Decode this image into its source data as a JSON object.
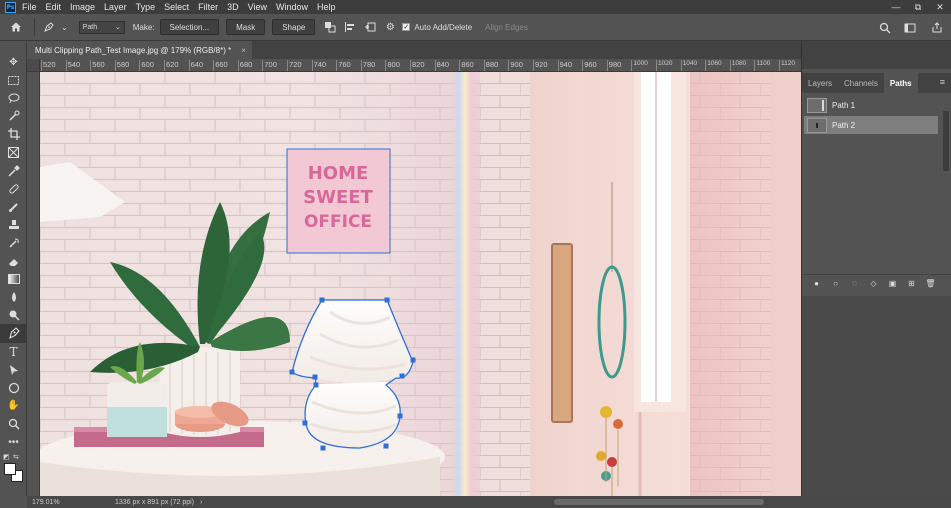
{
  "app": {
    "logo": "Ps"
  },
  "menu": [
    "File",
    "Edit",
    "Image",
    "Layer",
    "Type",
    "Select",
    "Filter",
    "3D",
    "View",
    "Window",
    "Help"
  ],
  "window_controls": {
    "minimize": "—",
    "restore": "⧉",
    "close": "✕"
  },
  "options": {
    "home_icon": "home-icon",
    "tool_mode": "Path",
    "make_label": "Make:",
    "selection_button": "Selection...",
    "mask_button": "Mask",
    "shape_button": "Shape",
    "auto_add_delete": "Auto Add/Delete",
    "auto_add_delete_checked": true,
    "align_edges": "Align Edges"
  },
  "document": {
    "tab_title": "Multi Clipping Path_Test Image.jpg @ 179% (RGB/8*) *",
    "close": "×"
  },
  "ruler": {
    "ticks": [
      "520",
      "540",
      "560",
      "580",
      "600",
      "620",
      "640",
      "660",
      "680",
      "700",
      "720",
      "740",
      "760",
      "780",
      "800",
      "820",
      "840",
      "860",
      "880",
      "900",
      "920",
      "940",
      "960",
      "980",
      "1000",
      "1020",
      "1040",
      "1060",
      "1080",
      "1100",
      "1120"
    ]
  },
  "status": {
    "zoom": "179.01%",
    "doc_size": "1336 px x 891 px (72 ppi)"
  },
  "panels": {
    "tabs": [
      "Layers",
      "Channels",
      "Paths"
    ],
    "active_tab": "Paths",
    "paths": [
      {
        "name": "Path 1",
        "selected": false
      },
      {
        "name": "Path 2",
        "selected": true
      }
    ]
  },
  "canvas": {
    "sign_lines": [
      "HOME",
      "SWEET",
      "OFFICE"
    ]
  },
  "colors": {
    "ui_bg": "#535353",
    "menubar": "#3c3c3c",
    "path_stroke": "#2f6fd6",
    "sign_pink": "#d9689a"
  }
}
